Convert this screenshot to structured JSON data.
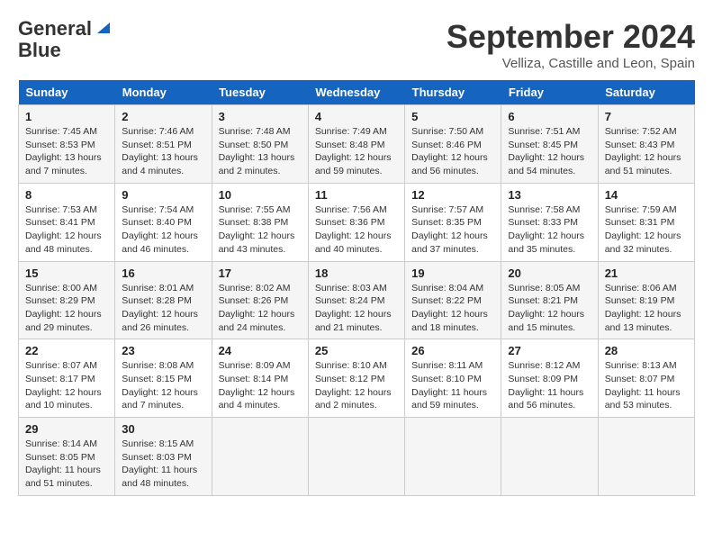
{
  "logo": {
    "line1": "General",
    "line2": "Blue"
  },
  "title": "September 2024",
  "subtitle": "Velliza, Castille and Leon, Spain",
  "days_of_week": [
    "Sunday",
    "Monday",
    "Tuesday",
    "Wednesday",
    "Thursday",
    "Friday",
    "Saturday"
  ],
  "weeks": [
    [
      {
        "num": "1",
        "sunrise": "Sunrise: 7:45 AM",
        "sunset": "Sunset: 8:53 PM",
        "daylight": "Daylight: 13 hours and 7 minutes."
      },
      {
        "num": "2",
        "sunrise": "Sunrise: 7:46 AM",
        "sunset": "Sunset: 8:51 PM",
        "daylight": "Daylight: 13 hours and 4 minutes."
      },
      {
        "num": "3",
        "sunrise": "Sunrise: 7:48 AM",
        "sunset": "Sunset: 8:50 PM",
        "daylight": "Daylight: 13 hours and 2 minutes."
      },
      {
        "num": "4",
        "sunrise": "Sunrise: 7:49 AM",
        "sunset": "Sunset: 8:48 PM",
        "daylight": "Daylight: 12 hours and 59 minutes."
      },
      {
        "num": "5",
        "sunrise": "Sunrise: 7:50 AM",
        "sunset": "Sunset: 8:46 PM",
        "daylight": "Daylight: 12 hours and 56 minutes."
      },
      {
        "num": "6",
        "sunrise": "Sunrise: 7:51 AM",
        "sunset": "Sunset: 8:45 PM",
        "daylight": "Daylight: 12 hours and 54 minutes."
      },
      {
        "num": "7",
        "sunrise": "Sunrise: 7:52 AM",
        "sunset": "Sunset: 8:43 PM",
        "daylight": "Daylight: 12 hours and 51 minutes."
      }
    ],
    [
      {
        "num": "8",
        "sunrise": "Sunrise: 7:53 AM",
        "sunset": "Sunset: 8:41 PM",
        "daylight": "Daylight: 12 hours and 48 minutes."
      },
      {
        "num": "9",
        "sunrise": "Sunrise: 7:54 AM",
        "sunset": "Sunset: 8:40 PM",
        "daylight": "Daylight: 12 hours and 46 minutes."
      },
      {
        "num": "10",
        "sunrise": "Sunrise: 7:55 AM",
        "sunset": "Sunset: 8:38 PM",
        "daylight": "Daylight: 12 hours and 43 minutes."
      },
      {
        "num": "11",
        "sunrise": "Sunrise: 7:56 AM",
        "sunset": "Sunset: 8:36 PM",
        "daylight": "Daylight: 12 hours and 40 minutes."
      },
      {
        "num": "12",
        "sunrise": "Sunrise: 7:57 AM",
        "sunset": "Sunset: 8:35 PM",
        "daylight": "Daylight: 12 hours and 37 minutes."
      },
      {
        "num": "13",
        "sunrise": "Sunrise: 7:58 AM",
        "sunset": "Sunset: 8:33 PM",
        "daylight": "Daylight: 12 hours and 35 minutes."
      },
      {
        "num": "14",
        "sunrise": "Sunrise: 7:59 AM",
        "sunset": "Sunset: 8:31 PM",
        "daylight": "Daylight: 12 hours and 32 minutes."
      }
    ],
    [
      {
        "num": "15",
        "sunrise": "Sunrise: 8:00 AM",
        "sunset": "Sunset: 8:29 PM",
        "daylight": "Daylight: 12 hours and 29 minutes."
      },
      {
        "num": "16",
        "sunrise": "Sunrise: 8:01 AM",
        "sunset": "Sunset: 8:28 PM",
        "daylight": "Daylight: 12 hours and 26 minutes."
      },
      {
        "num": "17",
        "sunrise": "Sunrise: 8:02 AM",
        "sunset": "Sunset: 8:26 PM",
        "daylight": "Daylight: 12 hours and 24 minutes."
      },
      {
        "num": "18",
        "sunrise": "Sunrise: 8:03 AM",
        "sunset": "Sunset: 8:24 PM",
        "daylight": "Daylight: 12 hours and 21 minutes."
      },
      {
        "num": "19",
        "sunrise": "Sunrise: 8:04 AM",
        "sunset": "Sunset: 8:22 PM",
        "daylight": "Daylight: 12 hours and 18 minutes."
      },
      {
        "num": "20",
        "sunrise": "Sunrise: 8:05 AM",
        "sunset": "Sunset: 8:21 PM",
        "daylight": "Daylight: 12 hours and 15 minutes."
      },
      {
        "num": "21",
        "sunrise": "Sunrise: 8:06 AM",
        "sunset": "Sunset: 8:19 PM",
        "daylight": "Daylight: 12 hours and 13 minutes."
      }
    ],
    [
      {
        "num": "22",
        "sunrise": "Sunrise: 8:07 AM",
        "sunset": "Sunset: 8:17 PM",
        "daylight": "Daylight: 12 hours and 10 minutes."
      },
      {
        "num": "23",
        "sunrise": "Sunrise: 8:08 AM",
        "sunset": "Sunset: 8:15 PM",
        "daylight": "Daylight: 12 hours and 7 minutes."
      },
      {
        "num": "24",
        "sunrise": "Sunrise: 8:09 AM",
        "sunset": "Sunset: 8:14 PM",
        "daylight": "Daylight: 12 hours and 4 minutes."
      },
      {
        "num": "25",
        "sunrise": "Sunrise: 8:10 AM",
        "sunset": "Sunset: 8:12 PM",
        "daylight": "Daylight: 12 hours and 2 minutes."
      },
      {
        "num": "26",
        "sunrise": "Sunrise: 8:11 AM",
        "sunset": "Sunset: 8:10 PM",
        "daylight": "Daylight: 11 hours and 59 minutes."
      },
      {
        "num": "27",
        "sunrise": "Sunrise: 8:12 AM",
        "sunset": "Sunset: 8:09 PM",
        "daylight": "Daylight: 11 hours and 56 minutes."
      },
      {
        "num": "28",
        "sunrise": "Sunrise: 8:13 AM",
        "sunset": "Sunset: 8:07 PM",
        "daylight": "Daylight: 11 hours and 53 minutes."
      }
    ],
    [
      {
        "num": "29",
        "sunrise": "Sunrise: 8:14 AM",
        "sunset": "Sunset: 8:05 PM",
        "daylight": "Daylight: 11 hours and 51 minutes."
      },
      {
        "num": "30",
        "sunrise": "Sunrise: 8:15 AM",
        "sunset": "Sunset: 8:03 PM",
        "daylight": "Daylight: 11 hours and 48 minutes."
      },
      null,
      null,
      null,
      null,
      null
    ]
  ]
}
